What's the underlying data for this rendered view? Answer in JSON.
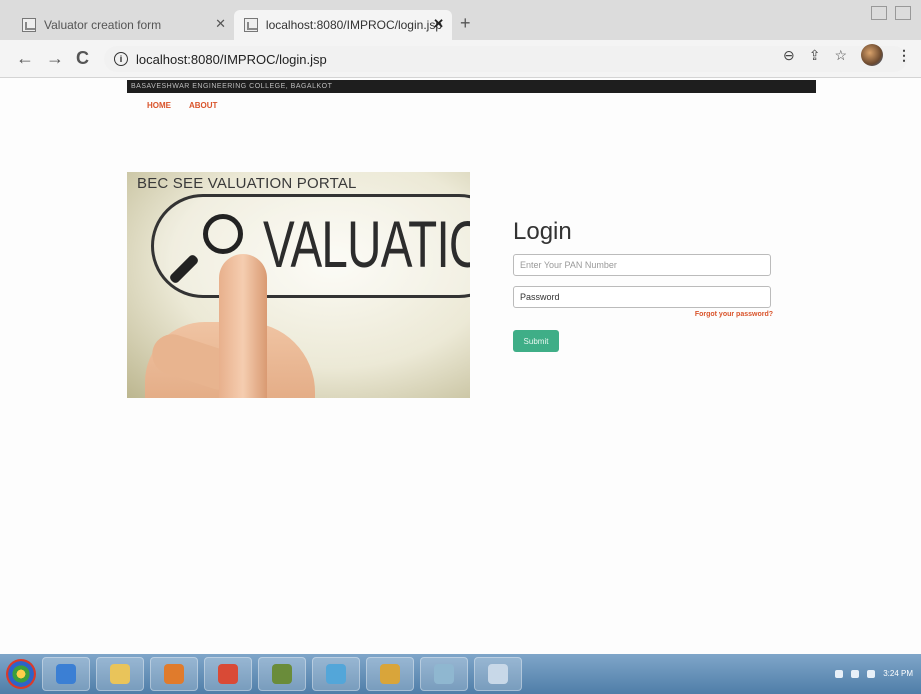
{
  "browser": {
    "tabs": [
      {
        "title": "Valuator creation form",
        "active": false
      },
      {
        "title": "localhost:8080/IMPROC/login.jsp",
        "active": true
      }
    ],
    "new_tab_label": "+",
    "address": "localhost:8080/IMPROC/login.jsp"
  },
  "page": {
    "banner_text": "BASAVESHWAR ENGINEERING COLLEGE, BAGALKOT",
    "menu": [
      {
        "label": "HOME"
      },
      {
        "label": "ABOUT"
      }
    ],
    "hero": {
      "title": "BEC SEE VALUATION PORTAL",
      "word": "VALUATION"
    },
    "login": {
      "heading": "Login",
      "pan_placeholder": "Enter Your PAN Number",
      "password_placeholder": "Password",
      "forgot_label": "Forgot your password?",
      "submit_label": "Submit"
    }
  },
  "taskbar": {
    "clock_time": "3:24 PM",
    "clock_date": "",
    "items": [
      {
        "name": "ie-icon",
        "color": "#3b7fd4"
      },
      {
        "name": "folder-icon",
        "color": "#e9c45a"
      },
      {
        "name": "media-player-icon",
        "color": "#e07b2c"
      },
      {
        "name": "chrome-icon",
        "color": "#d94a36"
      },
      {
        "name": "paint-icon",
        "color": "#6a8c3a"
      },
      {
        "name": "pin-icon",
        "color": "#53a6d9"
      },
      {
        "name": "files-icon",
        "color": "#d9a53a"
      },
      {
        "name": "note-icon",
        "color": "#8fb7d0"
      },
      {
        "name": "window-icon",
        "color": "#c8d8e8"
      }
    ]
  }
}
